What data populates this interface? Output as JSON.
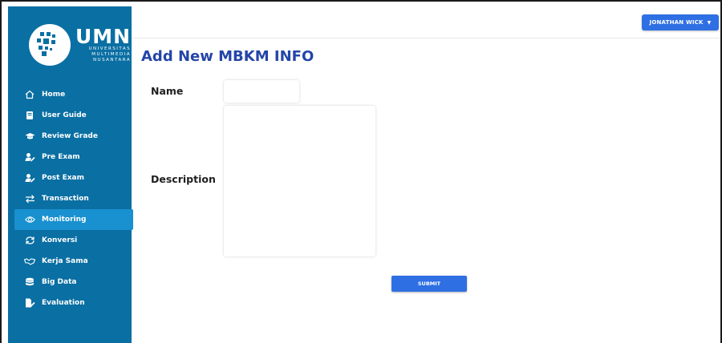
{
  "brand": {
    "logo_text": "UMN",
    "logo_sub": [
      "UNIVERSITAS",
      "MULTIMEDIA",
      "NUSANTARA"
    ]
  },
  "sidebar": {
    "items": [
      {
        "label": "Home",
        "icon": "home-icon",
        "active": false
      },
      {
        "label": "User Guide",
        "icon": "book-icon",
        "active": false
      },
      {
        "label": "Review Grade",
        "icon": "graduation-cap-icon",
        "active": false
      },
      {
        "label": "Pre Exam",
        "icon": "user-edit-icon",
        "active": false
      },
      {
        "label": "Post Exam",
        "icon": "user-edit-icon",
        "active": false
      },
      {
        "label": "Transaction",
        "icon": "exchange-icon",
        "active": false
      },
      {
        "label": "Monitoring",
        "icon": "eye-icon",
        "active": true
      },
      {
        "label": "Konversi",
        "icon": "sync-icon",
        "active": false
      },
      {
        "label": "Kerja Sama",
        "icon": "handshake-icon",
        "active": false
      },
      {
        "label": "Big Data",
        "icon": "database-icon",
        "active": false
      },
      {
        "label": "Evaluation",
        "icon": "file-edit-icon",
        "active": false
      }
    ]
  },
  "header": {
    "user_name": "JONATHAN WICK"
  },
  "main": {
    "title": "Add New MBKM INFO",
    "name_label": "Name",
    "name_value": "",
    "description_label": "Description",
    "description_value": "",
    "submit_label": "SUBMIT"
  },
  "colors": {
    "sidebar_bg": "#0a6fa3",
    "sidebar_active": "#1990cf",
    "primary_button": "#2f6fe4",
    "title_color": "#2445a8"
  }
}
